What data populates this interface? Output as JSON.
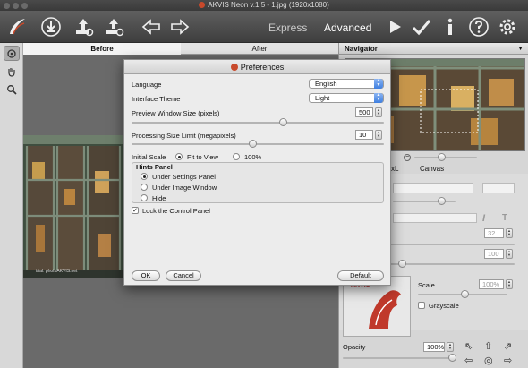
{
  "window": {
    "title": "AKVIS Neon v.1.5 - 1.jpg (1920x1080)"
  },
  "toolbar": {
    "modes": {
      "express": "Express",
      "advanced": "Advanced"
    }
  },
  "view_tabs": {
    "before": "Before",
    "after": "After"
  },
  "photo_credit": "trial: photoAKVIS.net",
  "navigator": {
    "title": "Navigator"
  },
  "settings_tabs": {
    "partial": "xL",
    "canvas": "Canvas"
  },
  "panel_values": {
    "v1": "32",
    "v2": "100"
  },
  "preset": {
    "scale_label": "Scale",
    "scale_value": "100%",
    "grayscale_label": "Grayscale",
    "logo_text": "AKVIS"
  },
  "opacity": {
    "label": "Opacity",
    "value": "100%"
  },
  "dialog": {
    "title": "Preferences",
    "language_label": "Language",
    "language_value": "English",
    "theme_label": "Interface Theme",
    "theme_value": "Light",
    "preview_label": "Preview Window Size (pixels)",
    "preview_value": "500",
    "preview_level": 0.6,
    "processing_label": "Processing Size Limit (megapixels)",
    "processing_value": "10",
    "processing_level": 0.48,
    "initial_scale_label": "Initial Scale",
    "fit_label": "Fit to View",
    "percent_label": "100%",
    "hints_title": "Hints Panel",
    "hint_opt1": "Under Settings Panel",
    "hint_opt2": "Under Image Window",
    "hint_opt3": "Hide",
    "lock_label": "Lock the Control Panel",
    "ok": "OK",
    "cancel": "Cancel",
    "default": "Default"
  }
}
